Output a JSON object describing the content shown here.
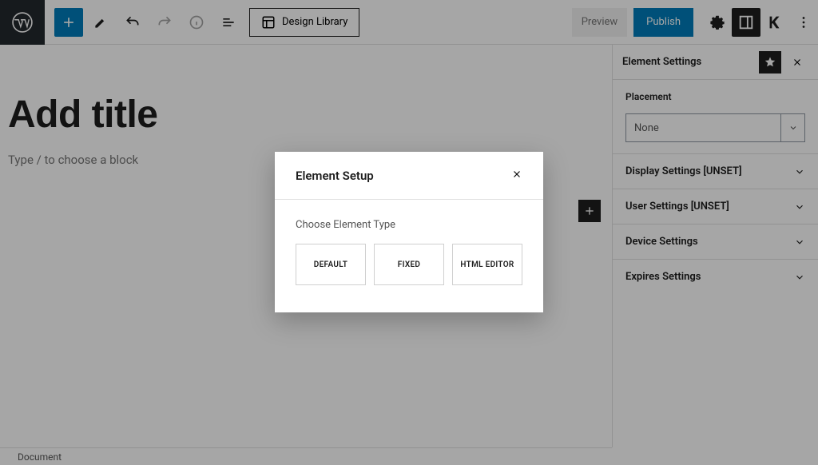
{
  "toolbar": {
    "design_library": "Design Library",
    "preview": "Preview",
    "publish": "Publish"
  },
  "canvas": {
    "title_placeholder": "Add title",
    "block_prompt": "Type / to choose a block"
  },
  "sidebar": {
    "header": "Element Settings",
    "placement_label": "Placement",
    "placement_value": "None",
    "panels": [
      "Display Settings [UNSET]",
      "User Settings [UNSET]",
      "Device Settings",
      "Expires Settings"
    ]
  },
  "footer": {
    "document": "Document"
  },
  "modal": {
    "title": "Element Setup",
    "subtitle": "Choose Element Type",
    "types": [
      "DEFAULT",
      "FIXED",
      "HTML EDITOR"
    ]
  }
}
